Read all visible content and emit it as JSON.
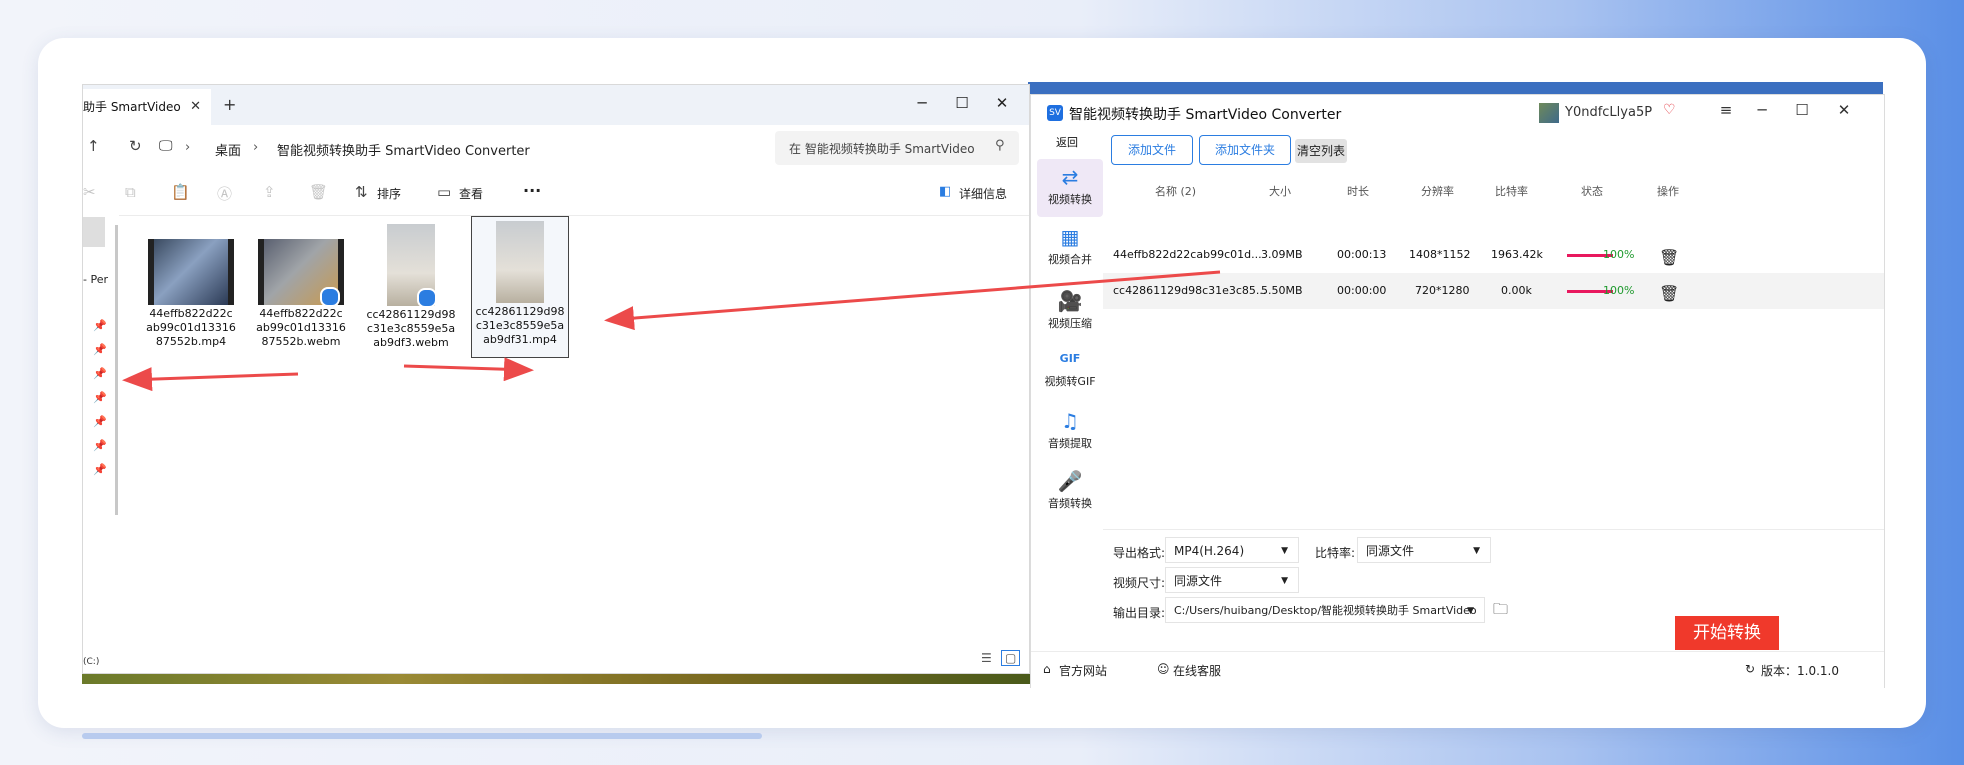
{
  "explorer": {
    "tab_label": "助手 SmartVideo",
    "tab_close": "✕",
    "new_tab": "+",
    "win_min": "─",
    "win_max": "☐",
    "win_close": "✕",
    "breadcrumb": [
      "桌面",
      "智能视频转换助手 SmartVideo Converter"
    ],
    "breadcrumb_sep": "›",
    "search_placeholder": "在 智能视频转换助手 SmartVideo",
    "toolbar": {
      "sort": "排序",
      "view": "查看",
      "more": "···",
      "details": "详细信息"
    },
    "side_fragment": "- Per",
    "bottom_fragment": "(C:)",
    "files": [
      {
        "name": "44effb822d22cab99c01d1331687552b.mp4",
        "lines": [
          "44effb822d22c",
          "ab99c01d13316",
          "87552b.mp4"
        ]
      },
      {
        "name": "44effb822d22cab99c01d1331687552b.webm",
        "lines": [
          "44effb822d22c",
          "ab99c01d13316",
          "87552b.webm"
        ]
      },
      {
        "name": "cc42861129d98c31e3c8559e5aab9df3.webm",
        "lines": [
          "cc42861129d98",
          "c31e3c8559e5a",
          "ab9df3.webm"
        ]
      },
      {
        "name": "cc42861129d98c31e3c8559e5aab9df31.mp4",
        "lines": [
          "cc42861129d98",
          "c31e3c8559e5a",
          "ab9df31.mp4"
        ]
      }
    ]
  },
  "app": {
    "logo": "SV",
    "title": "智能视频转换助手 SmartVideo Converter",
    "user": "Y0ndfcLlya5P",
    "vip_icon": "♡",
    "win_menu": "≡",
    "win_min": "─",
    "win_max": "☐",
    "win_close": "✕",
    "back": "返回",
    "nav": [
      "视频转换",
      "视频合并",
      "视频压缩",
      "视频转GIF",
      "音频提取",
      "音频转换"
    ],
    "buttons": {
      "add_file": "添加文件",
      "add_folder": "添加文件夹",
      "clear": "清空列表"
    },
    "columns": [
      "名称 (2)",
      "大小",
      "时长",
      "分辨率",
      "比特率",
      "状态",
      "操作"
    ],
    "rows": [
      {
        "name": "44effb822d22cab99c01d...",
        "size": "3.09MB",
        "duration": "00:00:13",
        "resolution": "1408*1152",
        "bitrate": "1963.42k",
        "status": "100%",
        "progress": 1.0
      },
      {
        "name": "cc42861129d98c31e3c85...",
        "size": "5.50MB",
        "duration": "00:00:00",
        "resolution": "720*1280",
        "bitrate": "0.00k",
        "status": "100%",
        "progress": 1.0
      }
    ],
    "settings": {
      "format_label": "导出格式:",
      "format_value": "MP4(H.264)",
      "bitrate_label": "比特率:",
      "bitrate_value": "同源文件",
      "size_label": "视频尺寸:",
      "size_value": "同源文件",
      "outdir_label": "输出目录:",
      "outdir_value": "C:/Users/huibang/Desktop/智能视频转换助手 SmartVideo"
    },
    "start_button": "开始转换",
    "footer": {
      "website": "官方网站",
      "support": "在线客服",
      "version": "版本：1.0.1.0"
    }
  },
  "colors": {
    "accent": "#2b7de1",
    "start": "#f0392b",
    "progress": "#e8185e",
    "pct": "#1f9a2e",
    "arrow": "#ec4a4a"
  }
}
